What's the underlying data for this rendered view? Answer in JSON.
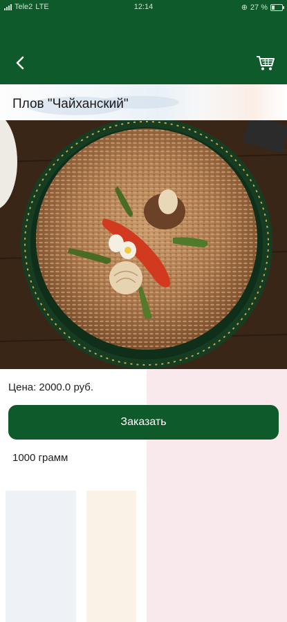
{
  "status_bar": {
    "carrier": "Tele2",
    "network": "LTE",
    "time": "12:14",
    "battery": "27 %",
    "battery_level": 0.27
  },
  "header": {
    "back_icon": "chevron-left-icon",
    "cart_icon": "shopping-cart-icon",
    "bg_color": "#0f5a2a"
  },
  "product": {
    "title": "Плов \"Чайханский\"",
    "price": "Цена: 2000.0 руб.",
    "order_label": "Заказать",
    "weight": "1000 грамм"
  },
  "colors": {
    "accent": "#0f5a2a"
  }
}
